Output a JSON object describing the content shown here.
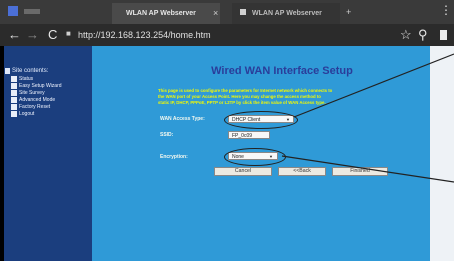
{
  "browser": {
    "tabs": [
      {
        "label": "WLAN AP Webserver",
        "close": "×"
      },
      {
        "label": "WLAN AP Webserver",
        "close": "×"
      }
    ],
    "new_tab": "+",
    "url": "http://192.168.123.254/home.htm"
  },
  "sidebar": {
    "title": "Site contents:",
    "items": [
      "Status",
      "Easy Setup Wizard",
      "Site Survey",
      "Advanced Mode",
      "Factory Reset",
      "Logout"
    ]
  },
  "main": {
    "title": "Wired WAN Interface Setup",
    "description": [
      "This page is used to configure the parameters for Internet network which connects to",
      "the WAN port of your Access Point. Here you may change the access method to",
      "static IP, DHCP, PPPoE, PPTP or L2TP by click the item value of WAN Access type."
    ],
    "wan_access_type_label": "WAN Access Type:",
    "wan_access_type_value": "DHCP Client",
    "ssid_label": "SSID:",
    "ssid_value": "FP_0c09",
    "encryption_label": "Encryption:",
    "encryption_value": "None",
    "buttons": {
      "cancel": "Cancel",
      "back": "<<Back",
      "finished": "Finished"
    }
  }
}
